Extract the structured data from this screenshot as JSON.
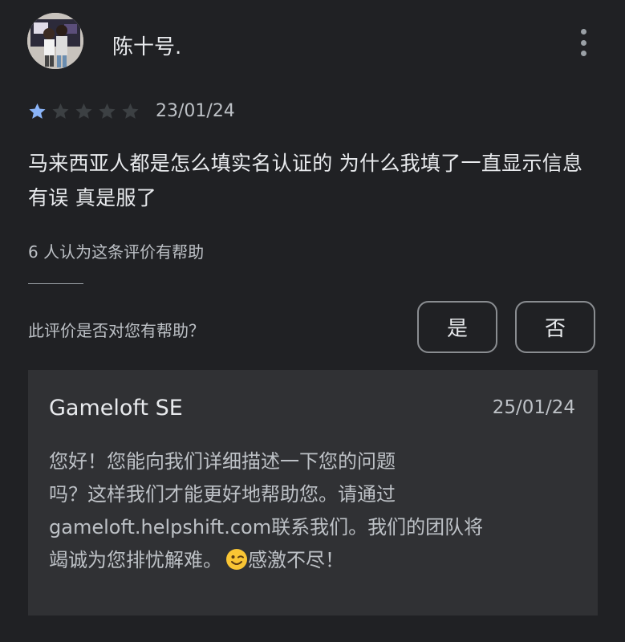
{
  "review": {
    "author": "陈十号.",
    "rating": 1,
    "max_rating": 5,
    "date": "23/01/24",
    "text": "马来西亚人都是怎么填实名认证的 为什么我填了一直显示信息有误 真是服了",
    "helpful_count_text": "6 人认为这条评价有帮助",
    "helpful_question": "此评价是否对您有帮助？",
    "yes_label": "是",
    "no_label": "否"
  },
  "reply": {
    "author": "Gameloft SE",
    "date": "25/01/24",
    "text_line_1": "您好！您能向我们详细描述一下您的问题",
    "text_line_2": "吗？这样我们才能更好地帮助您。请通过",
    "text_line_3": "gameloft.helpshift.com联系我们。我们的团队将",
    "text_line_4a": "竭诚为您排忧解难。",
    "emoji": "winking-face",
    "text_line_4b": "感激不尽！"
  },
  "colors": {
    "background": "#202124",
    "card": "#303134",
    "star_filled": "#8ab4f8",
    "star_empty": "#3c4043",
    "emoji_yellow": "#f9c534"
  },
  "icons": {
    "menu": "more-vert-icon",
    "star": "star-icon"
  }
}
